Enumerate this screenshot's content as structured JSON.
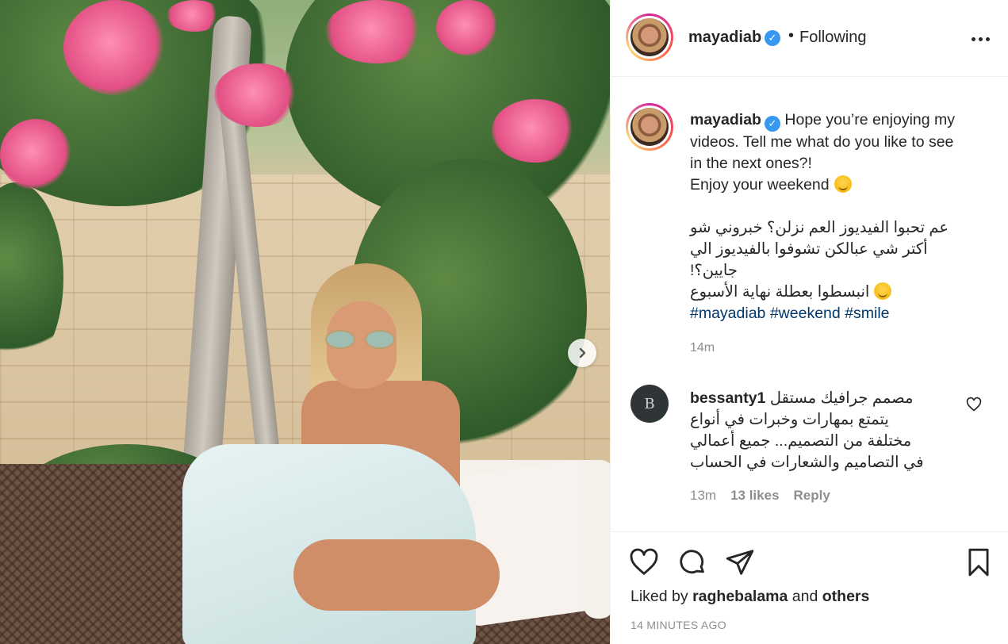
{
  "post": {
    "username": "mayadiab",
    "verified_icon": "verified-badge-icon",
    "dot": "•",
    "follow_status": "Following",
    "caption": {
      "line1": "Hope you’re enjoying my",
      "line2": "videos. Tell me what do you like to see",
      "line3": "in the next ones?!",
      "line4": "Enjoy your weekend",
      "arabic_line1": "عم تحبوا الفيديوز العم نزلن؟ خبروني شو",
      "arabic_line2": "أكتر شي عبالكن تشوفوا بالفيديوز الي",
      "arabic_line3": "جايين؟!",
      "arabic_line4": "انبسطوا بعطلة نهاية الأسبوع",
      "hashtags": [
        "#mayadiab",
        "#weekend",
        "#smile"
      ]
    },
    "caption_time": "14m",
    "comment": {
      "username": "bessanty1",
      "avatar_letter": "B",
      "line1": "مصمم جرافيك مستقل",
      "line2": "يتمتع بمهارات وخبرات في أنواع",
      "line3": "مختلفة من التصميم... جميع أعمالي",
      "line4": "في التصاميم والشعارات في الحساب",
      "time": "13m",
      "likes": "13 likes",
      "reply": "Reply"
    },
    "liked_by_prefix": "Liked by",
    "liked_by_user": "raghebalama",
    "liked_by_and": "and",
    "liked_by_others": "others",
    "timestamp": "14 MINUTES AGO"
  },
  "colors": {
    "verified": "#3897f0",
    "hashtag": "#00376b",
    "muted": "#8e8e8e"
  }
}
